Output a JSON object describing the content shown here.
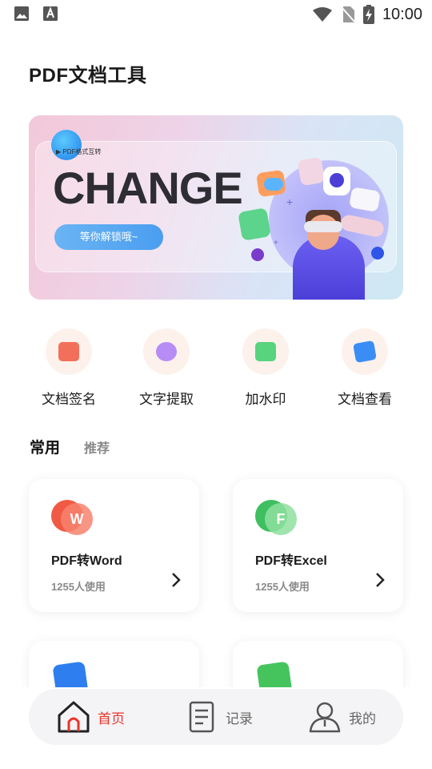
{
  "status_bar": {
    "time": "10:00",
    "left_icons": [
      "image-icon",
      "text-input-icon"
    ],
    "right_icons": [
      "wifi-icon",
      "no-sim-icon",
      "battery-charging-icon"
    ]
  },
  "app_title": "PDF文档工具",
  "banner": {
    "tag": "PDF格式互转",
    "headline": "CHANGE",
    "button_label": "等你解锁哦~"
  },
  "quick_tools": [
    {
      "label": "文档签名",
      "icon": "signature-icon",
      "color": "#f2705a"
    },
    {
      "label": "文字提取",
      "icon": "text-extract-icon",
      "color": "#b88cf5"
    },
    {
      "label": "加水印",
      "icon": "watermark-icon",
      "color": "#58d37e"
    },
    {
      "label": "文档查看",
      "icon": "document-view-icon",
      "color": "#3a8df5"
    }
  ],
  "section_tabs": {
    "active": "常用",
    "inactive": "推荐"
  },
  "cards": [
    {
      "title": "PDF转Word",
      "usage": "1255人使用",
      "icon_letter": "W",
      "icon": "word-icon",
      "color_back": "#f05a45",
      "color_front": "#f7836f"
    },
    {
      "title": "PDF转Excel",
      "usage": "1255人使用",
      "icon_letter": "F",
      "icon": "excel-icon",
      "color_back": "#3fbf5f",
      "color_front": "#8ee09f"
    },
    {
      "title": "",
      "usage": "",
      "icon": "pdf-blue-icon",
      "color_back": "#2f7ef0"
    },
    {
      "title": "",
      "usage": "",
      "icon": "pdf-green-icon",
      "color_back": "#45c45e"
    }
  ],
  "bottom_nav": [
    {
      "label": "首页",
      "icon": "home-icon",
      "active": true
    },
    {
      "label": "记录",
      "icon": "record-icon",
      "active": false
    },
    {
      "label": "我的",
      "icon": "profile-icon",
      "active": false
    }
  ],
  "colors": {
    "accent": "#e8342c",
    "banner_button": "#4a9ef0"
  }
}
